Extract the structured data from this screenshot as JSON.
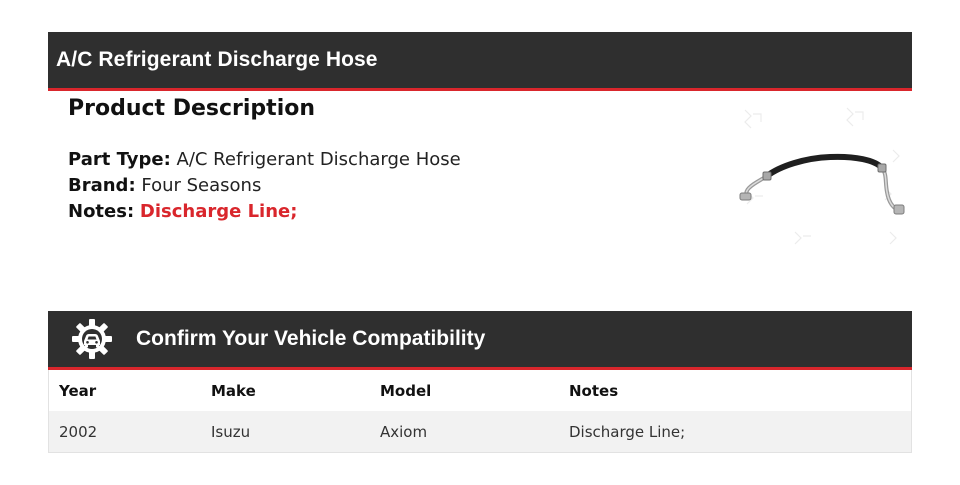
{
  "product": {
    "header_title": "A/C Refrigerant Discharge Hose",
    "section_title": "Product Description",
    "part_type_label": "Part Type:",
    "part_type_value": "A/C Refrigerant Discharge Hose",
    "brand_label": "Brand:",
    "brand_value": "Four Seasons",
    "notes_label": "Notes:",
    "notes_value": "Discharge Line;"
  },
  "compatibility": {
    "title": "Confirm Your Vehicle Compatibility",
    "icon": "gear-car-icon",
    "columns": [
      "Year",
      "Make",
      "Model",
      "Notes"
    ],
    "rows": [
      [
        "2002",
        "Isuzu",
        "Axiom",
        "Discharge Line;"
      ]
    ]
  },
  "colors": {
    "header_bg": "#2f2f2f",
    "accent": "#d9262c"
  }
}
